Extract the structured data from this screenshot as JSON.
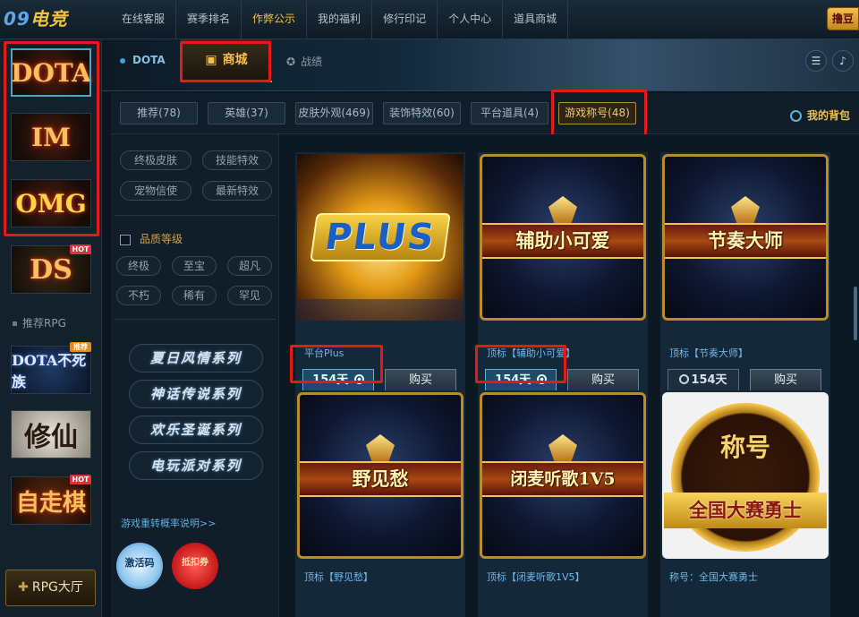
{
  "app": {
    "logo_text_a": "09",
    "logo_text_b": "电竞",
    "corner_button": "撸豆"
  },
  "topnav": [
    {
      "label": "在线客服",
      "active": false
    },
    {
      "label": "赛季排名",
      "active": false
    },
    {
      "label": "作弊公示",
      "active": true
    },
    {
      "label": "我的福利",
      "active": false
    },
    {
      "label": "修行印记",
      "active": false
    },
    {
      "label": "个人中心",
      "active": false
    },
    {
      "label": "道具商城",
      "active": false
    }
  ],
  "games": [
    {
      "label": "DOTA",
      "selected": true
    },
    {
      "label": "IM",
      "selected": false
    },
    {
      "label": "OMG",
      "selected": false
    },
    {
      "label": "DS",
      "hot": "HOT"
    }
  ],
  "recommended_label": "推荐RPG",
  "rpg_games": [
    {
      "label": "DOTA不死族",
      "badge": "推荐"
    },
    {
      "label": "修仙"
    },
    {
      "label": "自走棋",
      "badge": "HOT"
    }
  ],
  "rpg_hall": "RPG大厅",
  "main_tabs": {
    "dota": "DOTA",
    "shop": "商城",
    "stats": "战绩"
  },
  "categories": [
    {
      "label": "推荐(78)",
      "active": false
    },
    {
      "label": "英雄(37)",
      "active": false
    },
    {
      "label": "皮肤外观(469)",
      "active": false
    },
    {
      "label": "装饰特效(60)",
      "active": false
    },
    {
      "label": "平台道具(4)",
      "active": false
    },
    {
      "label": "游戏称号(48)",
      "active": true
    }
  ],
  "my_backpack": "我的背包",
  "filters": {
    "tags": [
      "终极皮肤",
      "技能特效",
      "宠物信使",
      "最新特效"
    ],
    "quality_title": "品质等级",
    "quality": [
      "终极",
      "至宝",
      "超凡",
      "不朽",
      "稀有",
      "罕见"
    ],
    "series": [
      "夏日风情系列",
      "神话传说系列",
      "欢乐圣诞系列",
      "电玩派对系列"
    ],
    "probability_link": "游戏重转概率说明>>",
    "activation_code": "激活码",
    "coupon": "抵扣券"
  },
  "products": [
    {
      "image_text": "PLUS",
      "name": "平台Plus",
      "duration": "154天",
      "selected": true,
      "buy": "购买"
    },
    {
      "image_text": "辅助小可爱",
      "name": "顶标【辅助小可爱】",
      "duration": "154天",
      "selected": true,
      "buy": "购买"
    },
    {
      "image_text": "节奏大师",
      "name": "顶标【节奏大师】",
      "duration": "154天",
      "selected": false,
      "buy": "购买"
    },
    {
      "image_text": "野见愁",
      "name": "顶标【野见愁】"
    },
    {
      "image_text": "闭麦听歌1V5",
      "name": "顶标【闭麦听歌1V5】"
    },
    {
      "image_text_top": "称号",
      "image_text": "全国大赛勇士",
      "name": "称号：全国大赛勇士"
    }
  ]
}
